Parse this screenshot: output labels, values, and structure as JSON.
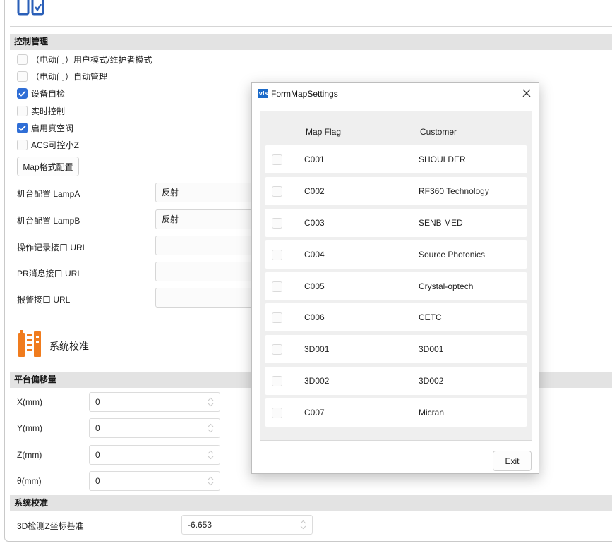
{
  "control_section": {
    "header": "控制管理",
    "checkboxes": [
      {
        "label": "（电动门）用户模式/维护者模式",
        "checked": false
      },
      {
        "label": "（电动门）自动管理",
        "checked": false
      },
      {
        "label": "设备自检",
        "checked": true
      },
      {
        "label": "实时控制",
        "checked": false
      },
      {
        "label": "启用真空阀",
        "checked": true
      },
      {
        "label": "ACS可控小Z",
        "checked": false
      }
    ],
    "map_button": "Map格式配置",
    "fields": [
      {
        "label": "机台配置 LampA",
        "value": "反射"
      },
      {
        "label": "机台配置 LampB",
        "value": "反射"
      },
      {
        "label": "操作记录接口 URL",
        "value": ""
      },
      {
        "label": "PR消息接口 URL",
        "value": ""
      },
      {
        "label": "报警接口 URL",
        "value": ""
      }
    ]
  },
  "calibration": {
    "title": "系统校准",
    "icon": "calibration-tool-icon",
    "accent_color": "#f07c1e"
  },
  "offset_section": {
    "header": "平台偏移量",
    "rows": [
      {
        "label": "X(mm)",
        "value": "0"
      },
      {
        "label": "Y(mm)",
        "value": "0"
      },
      {
        "label": "Z(mm)",
        "value": "0"
      },
      {
        "label": "θ(mm)",
        "value": "0"
      }
    ]
  },
  "system_calibration_section": {
    "header": "系统校准",
    "rows": [
      {
        "label": "3D检测Z坐标基准",
        "value": "-6.653"
      }
    ]
  },
  "dialog": {
    "title": "FormMapSettings",
    "app_icon_text": "vis",
    "columns": {
      "flag": "Map Flag",
      "customer": "Customer"
    },
    "rows": [
      {
        "flag": "C001",
        "customer": "SHOULDER",
        "checked": false
      },
      {
        "flag": "C002",
        "customer": "RF360 Technology",
        "checked": false
      },
      {
        "flag": "C003",
        "customer": "SENB MED",
        "checked": false
      },
      {
        "flag": "C004",
        "customer": "Source Photonics",
        "checked": false
      },
      {
        "flag": "C005",
        "customer": "Crystal-optech",
        "checked": false
      },
      {
        "flag": "C006",
        "customer": "CETC",
        "checked": false
      },
      {
        "flag": "3D001",
        "customer": "3D001",
        "checked": false
      },
      {
        "flag": "3D002",
        "customer": "3D002",
        "checked": false
      },
      {
        "flag": "C007",
        "customer": "Micran",
        "checked": false
      }
    ],
    "exit_button": "Exit"
  },
  "colors": {
    "checkbox_checked": "#2f6ed6",
    "section_header_bg": "#e3e3e3"
  }
}
